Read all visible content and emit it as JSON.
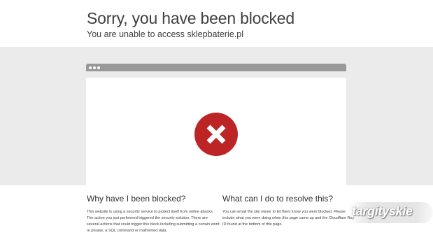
{
  "header": {
    "title": "Sorry, you have been blocked",
    "subtitle": "You are unable to access sklepbaterie.pl"
  },
  "browser": {
    "error_icon": "x-circle-icon",
    "error_color": "#bd2426"
  },
  "why": {
    "heading": "Why have I been blocked?",
    "body": "This website is using a security service to protect itself from online attacks. The action you just performed triggered the security solution. There are several actions that could trigger this block including submitting a certain word or phrase, a SQL command or malformed data."
  },
  "resolve": {
    "heading": "What can I do to resolve this?",
    "body": "You can email the site owner to let them know you were blocked. Please include what you were doing when this page came up and the Cloudflare Ray ID found at the bottom of this page."
  },
  "watermark": {
    "text": "targityskie"
  }
}
